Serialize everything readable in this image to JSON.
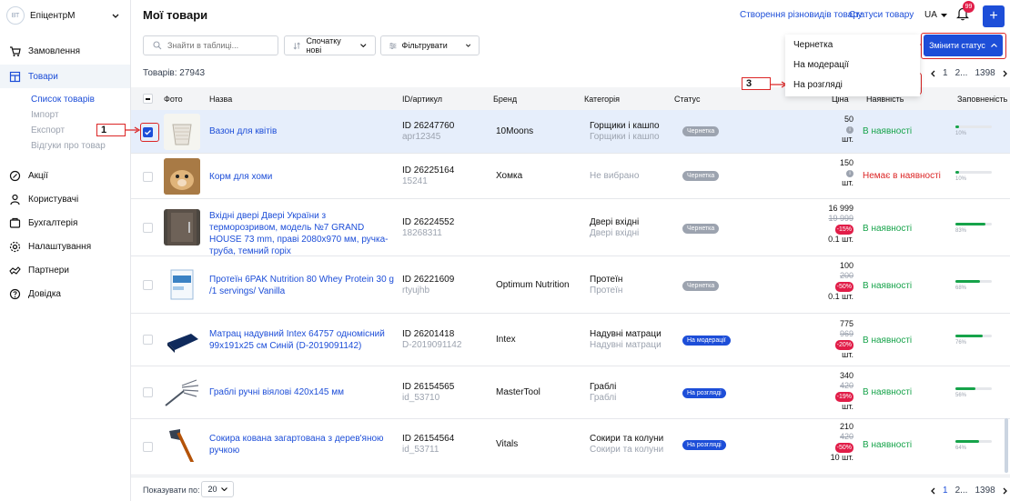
{
  "sidebar": {
    "avatar": "ВТ",
    "company": "ЕпіцентрМ",
    "items": [
      {
        "label": "Замовлення",
        "icon": "cart-icon"
      },
      {
        "label": "Товари",
        "icon": "products-icon"
      },
      {
        "label": "Акції",
        "icon": "promo-icon"
      },
      {
        "label": "Користувачі",
        "icon": "users-icon"
      },
      {
        "label": "Бухгалтерія",
        "icon": "accounting-icon"
      },
      {
        "label": "Налаштування",
        "icon": "settings-icon"
      },
      {
        "label": "Партнери",
        "icon": "partners-icon"
      },
      {
        "label": "Довідка",
        "icon": "help-icon"
      }
    ],
    "subitems": [
      "Список товарів",
      "Імпорт",
      "Експорт",
      "Відгуки про товар"
    ]
  },
  "header": {
    "title": "Мої товари",
    "link_variants": "Створення різновидів товару",
    "link_statuses": "Статуси товару",
    "lang": "UA",
    "notifications": "99",
    "add": "+"
  },
  "toolbar": {
    "search_placeholder": "Знайти в таблиці...",
    "sort_label": "Спочатку нові",
    "filter_label": "Фільтрувати",
    "change_status": "Змінити статус"
  },
  "status_menu": [
    "Чернетка",
    "На модерації",
    "На розгляді"
  ],
  "summary": {
    "count": "Товарів: 27943"
  },
  "pager": {
    "first": "1",
    "sep": "2...",
    "last": "1398"
  },
  "columns": [
    "Фото",
    "Назва",
    "ID/артикул",
    "Бренд",
    "Категорія",
    "Статус",
    "Ціна",
    "Наявність",
    "Заповненість"
  ],
  "rows": [
    {
      "name": "Вазон для квітів",
      "id": "ID 26247760",
      "sku": "apr12345",
      "brand": "10Moons",
      "cat": "Горщики і кашпо",
      "cat_sub": "Горщики і кашпо",
      "status": "Чернетка",
      "price": "50",
      "old": "",
      "disc": "",
      "qty": "шт.",
      "avail": "В наявності",
      "fill": "10%",
      "fill_value": 0.1,
      "selected": true
    },
    {
      "name": "Корм для хоми",
      "id": "ID 26225164",
      "sku": "15241",
      "brand": "Хомка",
      "cat": "Не вибрано",
      "cat_sub": "",
      "status": "Чернетка",
      "price": "150",
      "old": "",
      "disc": "",
      "qty": "шт.",
      "avail": "Немає в наявності",
      "fill": "10%",
      "fill_value": 0.1,
      "selected": false
    },
    {
      "name": "Вхідні двері Двері України з терморозривом, модель №7 GRAND HOUSE 73 mm, праві 2080x970 мм, ручка-труба, темний горіх",
      "id": "ID 26224552",
      "sku": "18268311",
      "brand": "",
      "cat": "Двері вхідні",
      "cat_sub": "Двері вхідні",
      "status": "Чернетка",
      "price": "16 999",
      "old": "19 999",
      "disc": "-15%",
      "qty": "0.1 шт.",
      "avail": "В наявності",
      "fill": "83%",
      "fill_value": 0.83,
      "selected": false
    },
    {
      "name": "Протеїн 6PAK Nutrition 80 Whey Protein 30 g /1 servings/ Vanilla",
      "id": "ID 26221609",
      "sku": "rtyujhb",
      "brand": "Optimum Nutrition",
      "cat": "Протеїн",
      "cat_sub": "Протеїн",
      "status": "Чернетка",
      "price": "100",
      "old": "200",
      "disc": "-50%",
      "qty": "0.1 шт.",
      "avail": "В наявності",
      "fill": "68%",
      "fill_value": 0.68,
      "selected": false
    },
    {
      "name": "Матрац надувний Intex 64757 одномісний 99x191x25 см Синій (D-2019091142)",
      "id": "ID 26201418",
      "sku": "D-2019091142",
      "brand": "Intex",
      "cat": "Надувні матраци",
      "cat_sub": "Надувні матраци",
      "status": "На модерації",
      "price": "775",
      "old": "969",
      "disc": "-20%",
      "qty": "шт.",
      "avail": "В наявності",
      "fill": "76%",
      "fill_value": 0.76,
      "selected": false
    },
    {
      "name": "Граблі ручні віялові 420x145 мм",
      "id": "ID 26154565",
      "sku": "id_53710",
      "brand": "MasterTool",
      "cat": "Граблі",
      "cat_sub": "Граблі",
      "status": "На розгляді",
      "price": "340",
      "old": "420",
      "disc": "-19%",
      "qty": "шт.",
      "avail": "В наявності",
      "fill": "56%",
      "fill_value": 0.56,
      "selected": false
    },
    {
      "name": "Сокира кована загартована з дерев'яною ручкою",
      "id": "ID 26154564",
      "sku": "id_53711",
      "brand": "Vitals",
      "cat": "Сокири та колуни",
      "cat_sub": "Сокири та колуни",
      "status": "На розгляді",
      "price": "210",
      "old": "420",
      "disc": "-50%",
      "qty": "10 шт.",
      "avail": "В наявності",
      "fill": "64%",
      "fill_value": 0.64,
      "selected": false
    }
  ],
  "footer": {
    "per_page_label": "Показувати по:",
    "per_page": "20"
  },
  "callouts": [
    "1",
    "2",
    "3"
  ],
  "colors": {
    "accent": "#1d4ed8",
    "callout": "#dc2626",
    "in_stock": "#16a34a",
    "out_stock": "#dc2626"
  }
}
